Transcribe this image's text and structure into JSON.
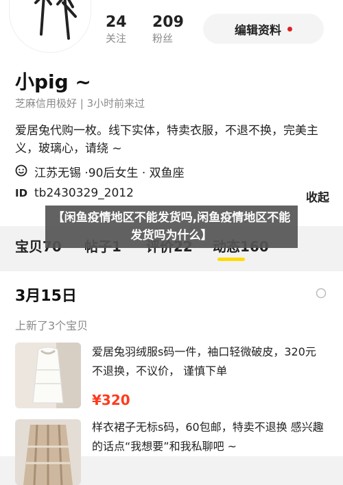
{
  "profile": {
    "following_count": "24",
    "following_label": "关注",
    "fans_count": "209",
    "fans_label": "粉丝",
    "edit_label": "编辑资料",
    "nickname": "小pig ~",
    "meta": "芝麻信用极好 | 3小时前来过",
    "bio": "爱居兔代购一枚。线下实体，特卖衣服，不退不换，完美主义，玻璃心，请绕 ~",
    "location_line": "江苏无锡 ·90后女生 · 双鱼座",
    "id_label": "ID",
    "id_value": "tb2430329_2012",
    "fold_label": "收起"
  },
  "tabs": [
    {
      "label": "宝贝70"
    },
    {
      "label": "帖子1"
    },
    {
      "label": "评价22"
    },
    {
      "label": "动态160"
    }
  ],
  "overlay_banner": "【闲鱼疫情地区不能发货吗,闲鱼疫情地区不能发货吗为什么】",
  "feed": {
    "date": "3月15日",
    "subtitle": "上新了3个宝贝",
    "items": [
      {
        "title": "爱居兔羽绒服s码一件，袖口轻微破皮，320元不退换，不议价，  谨慎下单",
        "price": "¥320"
      },
      {
        "title": "样衣裙子无标s码，60包邮，特卖不退换 感兴趣的话点“我想要”和我私聊吧 ~",
        "price": ""
      }
    ]
  },
  "colors": {
    "accent": "#ffda00",
    "price": "#ff3b1e",
    "dot": "#e02020"
  }
}
